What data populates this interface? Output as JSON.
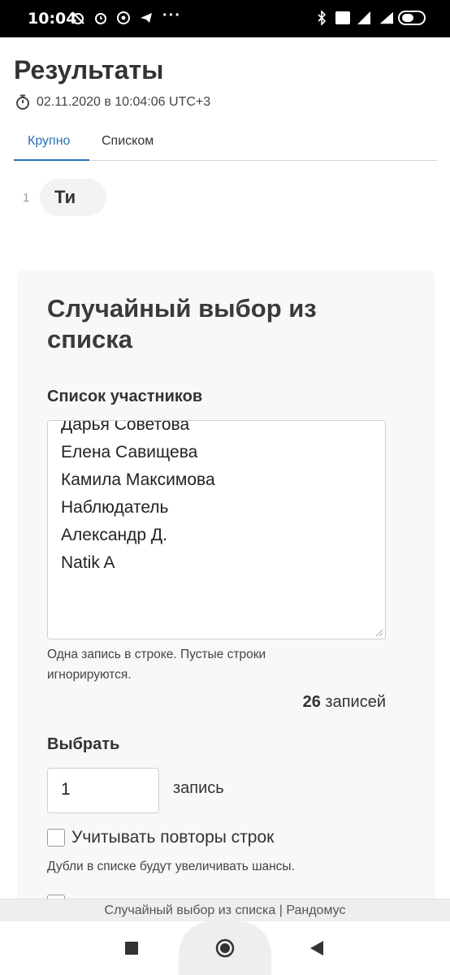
{
  "status_bar": {
    "time": "10:04",
    "dots": "···",
    "icons_left": [
      "alarm-off-icon",
      "alarm-icon",
      "whatsapp-icon",
      "telegram-icon"
    ],
    "icons_right": [
      "bluetooth-icon",
      "volte-icon",
      "signal-icon",
      "4g-signal-icon",
      "battery-icon"
    ]
  },
  "header": {
    "title": "Результаты",
    "timestamp": "02.11.2020 в 10:04:06 UTC+3"
  },
  "tabs": [
    {
      "label": "Крупно",
      "active": true
    },
    {
      "label": "Списком",
      "active": false
    }
  ],
  "results": [
    {
      "index": "1",
      "value": "Ти"
    }
  ],
  "card": {
    "title": "Случайный выбор из списка",
    "participants_label": "Список участников",
    "participants_lines": [
      "Дарья Советова",
      "Елена Савищева",
      "Камила Максимова",
      "Наблюдатель",
      "Александр Д.",
      "Natik A"
    ],
    "hint": "Одна запись в строке. Пустые строки игнорируются.",
    "count_number": "26",
    "count_suffix": "записей",
    "choose_label": "Выбрать",
    "choose_value": "1",
    "choose_unit": "запись",
    "repeat_checkbox_label": "Учитывать повторы строк",
    "repeat_checked": false,
    "repeat_hint": "Дубли в списке будут увеличивать шансы."
  },
  "footer": {
    "text": "Случайный выбор из списка | Рандомус"
  },
  "colors": {
    "accent": "#2a6fb8",
    "card_bg": "#f8f8f8",
    "chip_bg": "#f3f3f3"
  }
}
